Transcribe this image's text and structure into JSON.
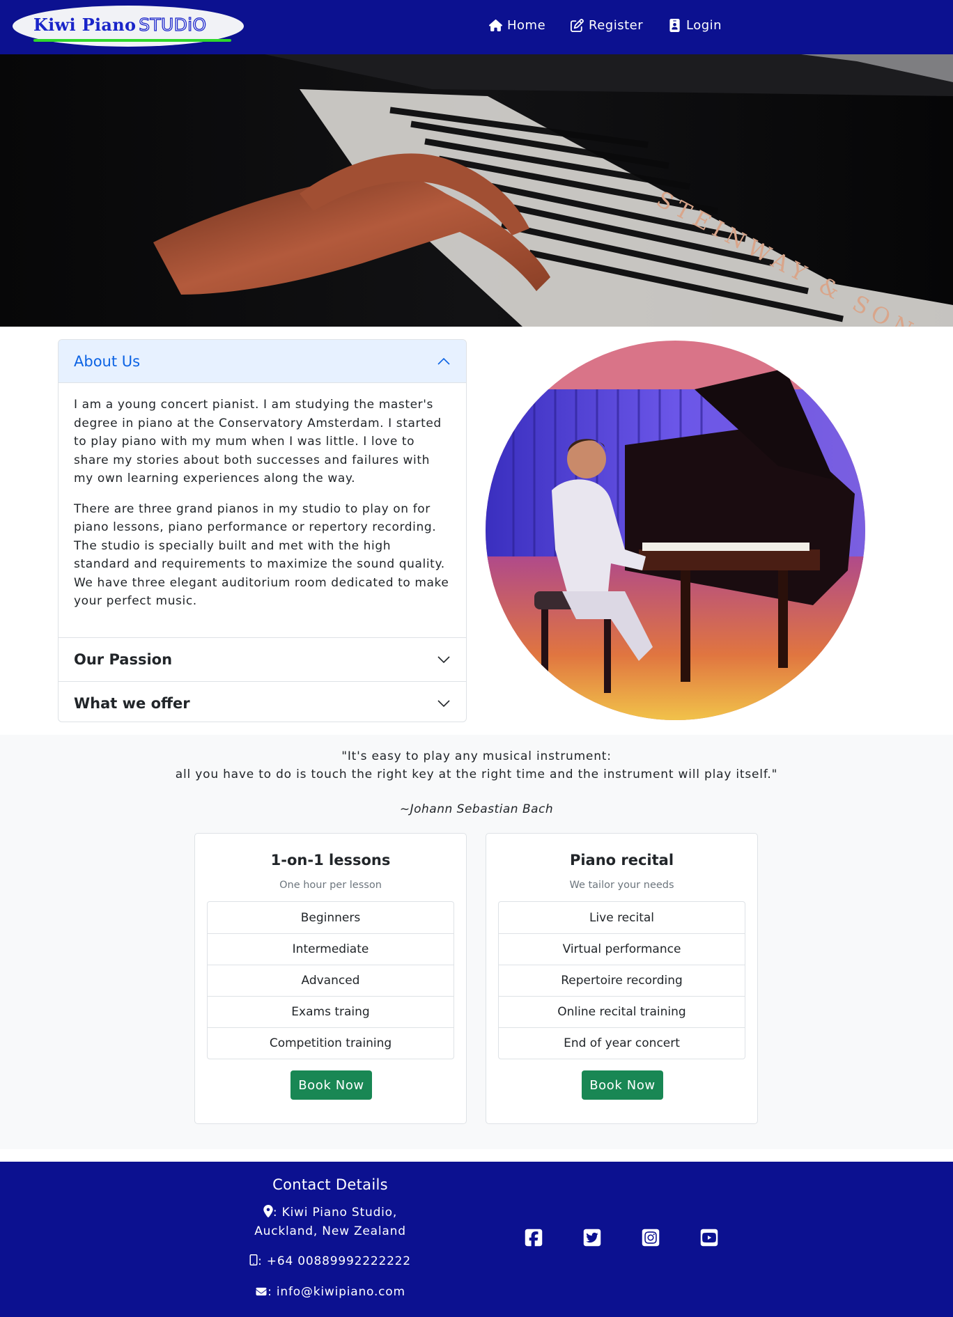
{
  "brand": {
    "name_part1": "Kiwi Piano",
    "name_part2": "STUDiO",
    "logo_colors": {
      "text": "#1a25c9",
      "underline": "#2fd72c"
    }
  },
  "nav": {
    "items": [
      {
        "label": "Home",
        "icon": "home-icon"
      },
      {
        "label": "Register",
        "icon": "edit-icon"
      },
      {
        "label": "Login",
        "icon": "id-card-icon"
      }
    ],
    "background": "#0c1190"
  },
  "hero": {
    "piano_brand": "STEINWAY & SONS"
  },
  "accordion": {
    "items": [
      {
        "title": "About Us",
        "expanded": true,
        "paragraphs": [
          "I am a young concert pianist. I am studying the master's degree in piano at the Conservatory Amsterdam. I started to play piano with my mum when I was little. I love to share my stories about both successes and failures with my own learning experiences along the way.",
          "There are three grand pianos in my studio to play on for piano lessons, piano performance or repertory recording. The studio is specially built and met with the high standard and requirements to maximize the sound quality. We have three elegant auditorium room dedicated to make your perfect music."
        ]
      },
      {
        "title": "Our Passion",
        "expanded": false
      },
      {
        "title": "What we offer",
        "expanded": false
      }
    ]
  },
  "quote": {
    "line1": "\"It's easy to play any musical instrument:",
    "line2": "all you have to do is touch the right key at the right time and the instrument will play itself.\"",
    "author": "~Johann Sebastian Bach"
  },
  "cards": [
    {
      "title": "1-on-1 lessons",
      "subtitle": "One hour per lesson",
      "items": [
        "Beginners",
        "Intermediate",
        "Advanced",
        "Exams traing",
        "Competition training"
      ],
      "button": "Book Now"
    },
    {
      "title": "Piano recital",
      "subtitle": "We tailor your needs",
      "items": [
        "Live recital",
        "Virtual performance",
        "Repertoire recording",
        "Online recital training",
        "End of year concert"
      ],
      "button": "Book Now"
    }
  ],
  "footer": {
    "title": "Contact Details",
    "address_line1": ": Kiwi Piano Studio,",
    "address_line2": "Auckland, New Zealand",
    "phone": ": +64 00889992222222",
    "email": ": info@kiwipiano.com",
    "social": [
      "facebook-icon",
      "twitter-icon",
      "instagram-icon",
      "youtube-icon"
    ]
  },
  "colors": {
    "accent_blue": "#0c63e4",
    "button_green": "#198754",
    "navy": "#0c1190"
  }
}
